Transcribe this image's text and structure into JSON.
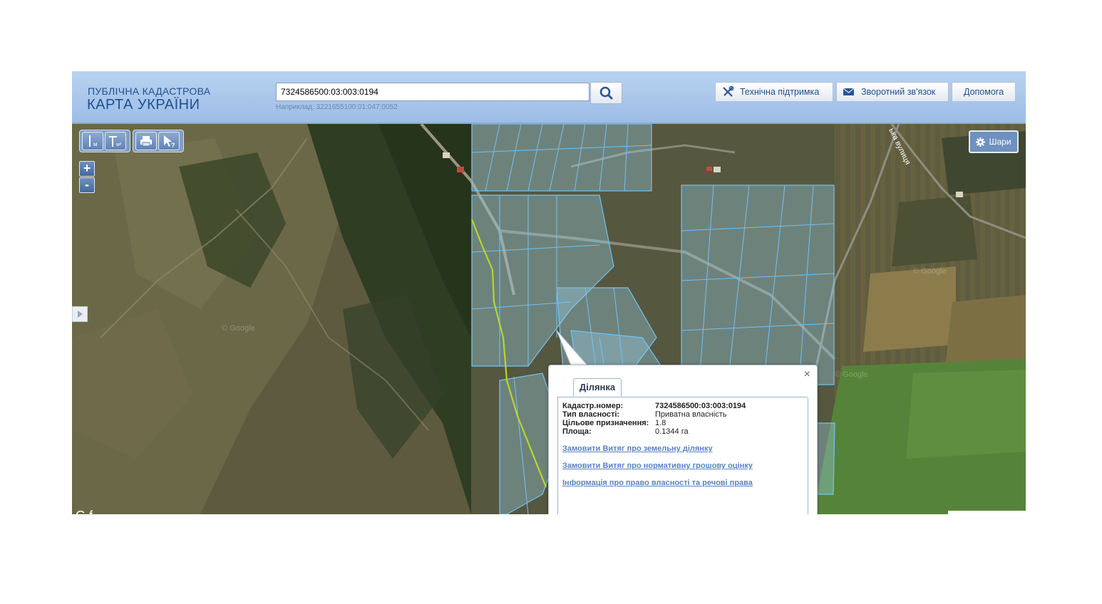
{
  "header": {
    "logo_line1": "ПУБЛІЧНА КАДАСТРОВА",
    "logo_line2": "КАРТА УКРАЇНИ",
    "search_value": "7324586500:03:003:0194",
    "search_hint": "Наприклад: 3221655100:01:047:0052",
    "buttons": {
      "support": "Технічна підтримка",
      "feedback": "Зворотний зв'язок",
      "help": "Допомога"
    }
  },
  "map_tools": {
    "measure_length_label": "м",
    "measure_area_label": "м²",
    "zoom_in": "+",
    "zoom_out": "-",
    "layers_label": "Шари"
  },
  "map_labels": {
    "street_label": "ька вулиця",
    "watermark": "© Google"
  },
  "popup": {
    "tab_label": "Ділянка",
    "close_symbol": "×",
    "fields": [
      {
        "label": "Кадастр.номер:",
        "value": "7324586500:03:003:0194"
      },
      {
        "label": "Тип власності:",
        "value": "Приватна власність"
      },
      {
        "label": "Цільове призначення:",
        "value": "1.8"
      },
      {
        "label": "Площа:",
        "value": "0.1344 га"
      }
    ],
    "links": [
      "Замовити Витяг про земельну ділянку",
      "Замовити Витяг про нормативну грошову оцінку",
      "Інформація про право власності та речові права"
    ]
  },
  "footer": {
    "attribution_partial": "G   f"
  },
  "colors": {
    "header_blue": "#a9c6ea",
    "parcel_stroke": "#6fc3f4",
    "stream_line": "#b5d82a",
    "link": "#5a83c2"
  }
}
